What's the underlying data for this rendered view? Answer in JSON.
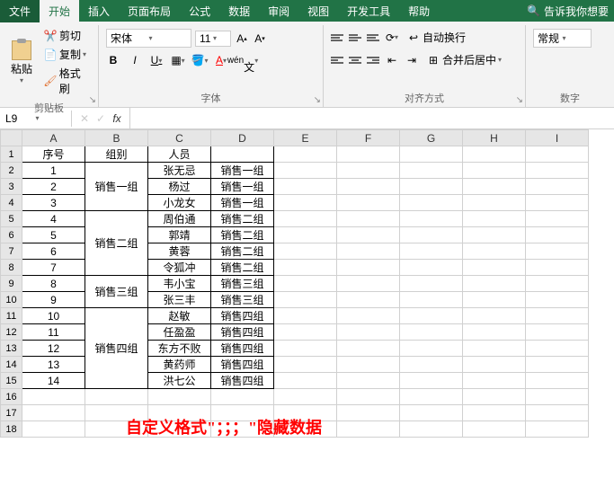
{
  "menubar": {
    "file": "文件",
    "tabs": [
      "开始",
      "插入",
      "页面布局",
      "公式",
      "数据",
      "审阅",
      "视图",
      "开发工具",
      "帮助"
    ],
    "active_index": 0,
    "search_hint": "告诉我你想要"
  },
  "ribbon": {
    "clipboard": {
      "label": "剪贴板",
      "paste": "粘贴",
      "cut": "剪切",
      "copy": "复制",
      "fmt": "格式刷"
    },
    "font": {
      "label": "字体",
      "font_name": "宋体",
      "font_size": "11",
      "bold": "B",
      "italic": "I",
      "underline": "U"
    },
    "alignment": {
      "label": "对齐方式",
      "wrap": "自动换行",
      "merge": "合并后居中"
    },
    "number": {
      "label": "数字",
      "format": "常规"
    }
  },
  "namebar": {
    "ref": "L9"
  },
  "cols": [
    "A",
    "B",
    "C",
    "D",
    "E",
    "F",
    "G",
    "H",
    "I"
  ],
  "headers": {
    "A": "序号",
    "B": "组别",
    "C": "人员",
    "D": ""
  },
  "rows": [
    {
      "r": 2,
      "A": "1",
      "C": "张无忌",
      "D": "销售一组"
    },
    {
      "r": 3,
      "A": "2",
      "C": "杨过",
      "D": "销售一组"
    },
    {
      "r": 4,
      "A": "3",
      "C": "小龙女",
      "D": "销售一组"
    },
    {
      "r": 5,
      "A": "4",
      "C": "周伯通",
      "D": "销售二组"
    },
    {
      "r": 6,
      "A": "5",
      "C": "郭靖",
      "D": "销售二组"
    },
    {
      "r": 7,
      "A": "6",
      "C": "黄蓉",
      "D": "销售二组"
    },
    {
      "r": 8,
      "A": "7",
      "C": "令狐冲",
      "D": "销售二组"
    },
    {
      "r": 9,
      "A": "8",
      "C": "韦小宝",
      "D": "销售三组"
    },
    {
      "r": 10,
      "A": "9",
      "C": "张三丰",
      "D": "销售三组"
    },
    {
      "r": 11,
      "A": "10",
      "C": "赵敏",
      "D": "销售四组"
    },
    {
      "r": 12,
      "A": "11",
      "C": "任盈盈",
      "D": "销售四组"
    },
    {
      "r": 13,
      "A": "12",
      "C": "东方不败",
      "D": "销售四组"
    },
    {
      "r": 14,
      "A": "13",
      "C": "黄药师",
      "D": "销售四组"
    },
    {
      "r": 15,
      "A": "14",
      "C": "洪七公",
      "D": "销售四组"
    }
  ],
  "merged_B": [
    {
      "start": 2,
      "end": 4,
      "text": "销售一组"
    },
    {
      "start": 5,
      "end": 8,
      "text": "销售二组"
    },
    {
      "start": 9,
      "end": 10,
      "text": "销售三组"
    },
    {
      "start": 11,
      "end": 15,
      "text": "销售四组"
    }
  ],
  "note": "自定义格式\"；；；\"隐藏数据"
}
